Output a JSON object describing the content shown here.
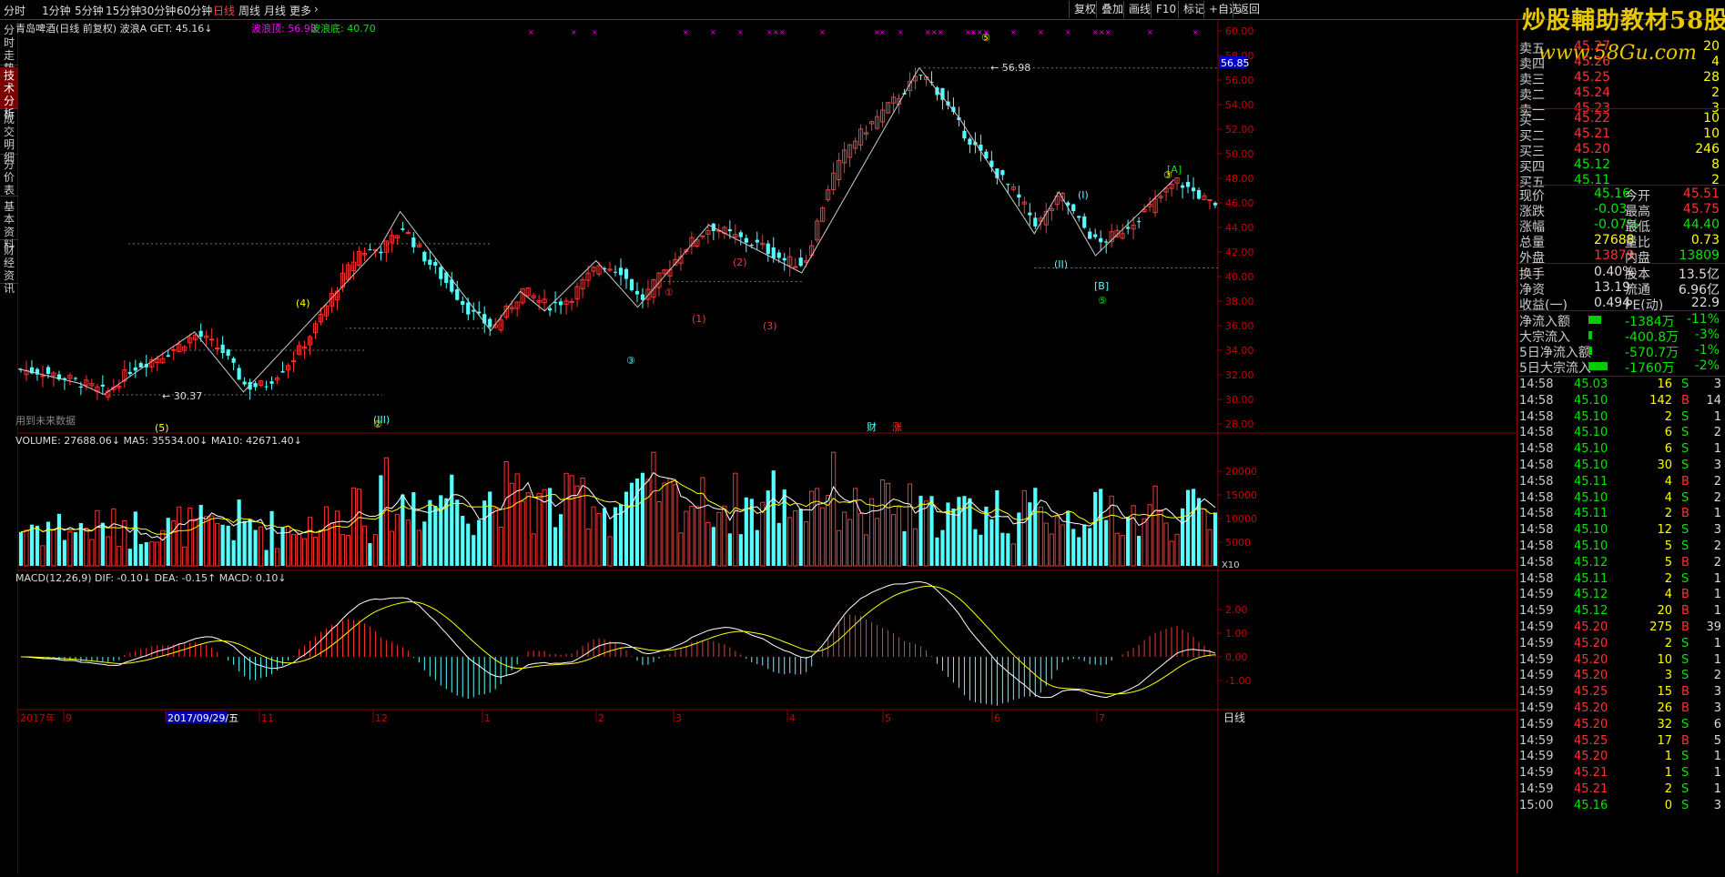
{
  "toolbar": {
    "periods": [
      "分时",
      "1分钟",
      "5分钟",
      "15分钟",
      "30分钟",
      "60分钟",
      "日线",
      "周线",
      "月线",
      "更多",
      "›"
    ],
    "active_period": "日线",
    "right_buttons": [
      "复权",
      "叠加",
      "画线",
      "F10",
      "标记",
      "+自选",
      "返回"
    ]
  },
  "left_tabs": [
    "分时走势",
    "技术分析",
    "成交明细",
    "分价表",
    "基本资料",
    "财经资讯"
  ],
  "active_left_tab": "技术分析",
  "watermark": {
    "line1": "炒股輔助教材58股网",
    "line2": "www.58Gu.com"
  },
  "main_chart": {
    "title": "青岛啤酒(日线 前复权) 波浪A  GET: 45.16↓",
    "wave_top_label": "波浪顶: 56.98",
    "wave_bottom_label": "波浪底: 40.70",
    "price_axis": [
      "60.00",
      "58.00",
      "56.00",
      "54.00",
      "52.00",
      "50.00",
      "48.00",
      "46.00",
      "44.00",
      "42.00",
      "40.00",
      "38.00",
      "36.00",
      "34.00",
      "32.00",
      "30.00",
      "28.00"
    ],
    "current_price_tag": "56.85",
    "peak_label": "56.98",
    "low_label": "30.37",
    "future_note": "用到未来数据",
    "cai_label": "财",
    "zhang_label": "涨"
  },
  "wave_labels": [
    "⑤",
    "①",
    "(1)",
    "(2)",
    "(3)",
    "(4)",
    "(5)",
    "②",
    "③",
    "(III)",
    "(II)",
    "(I)",
    "[B]",
    "[A]",
    "⑤",
    "③"
  ],
  "volume": {
    "title": "VOLUME: 27688.06↓  MA5: 35534.00↓  MA10: 42671.40↓",
    "axis": [
      "20000",
      "15000",
      "10000",
      "5000"
    ],
    "unit": "X10"
  },
  "macd": {
    "title": "MACD(12,26,9)  DIF: -0.10↓  DEA: -0.15↑  MACD: 0.10↓",
    "axis": [
      "2.00",
      "1.00",
      "0.00",
      "-1.00"
    ]
  },
  "time_axis": [
    "2017年",
    "9",
    "2017/09/29/五",
    "11",
    "12",
    "1",
    "2",
    "3",
    "4",
    "5",
    "6",
    "7"
  ],
  "bottom_tab": "日线",
  "order_book": {
    "sells": [
      {
        "label": "卖五",
        "price": "45.27",
        "vol": "20"
      },
      {
        "label": "卖四",
        "price": "45.26",
        "vol": "4"
      },
      {
        "label": "卖三",
        "price": "45.25",
        "vol": "28"
      },
      {
        "label": "卖二",
        "price": "45.24",
        "vol": "2"
      },
      {
        "label": "卖一",
        "price": "45.23",
        "vol": "3"
      }
    ],
    "buys": [
      {
        "label": "买一",
        "price": "45.22",
        "vol": "10"
      },
      {
        "label": "买二",
        "price": "45.21",
        "vol": "10"
      },
      {
        "label": "买三",
        "price": "45.20",
        "vol": "246"
      },
      {
        "label": "买四",
        "price": "45.12",
        "vol": "8"
      },
      {
        "label": "买五",
        "price": "45.11",
        "vol": "2"
      }
    ]
  },
  "quote": [
    {
      "l1": "现价",
      "v1": "45.16",
      "l2": "今开",
      "v2": "45.51"
    },
    {
      "l1": "涨跌",
      "v1": "-0.03",
      "l2": "最高",
      "v2": "45.75"
    },
    {
      "l1": "涨幅",
      "v1": "-0.07%",
      "l2": "最低",
      "v2": "44.40"
    },
    {
      "l1": "总量",
      "v1": "27688",
      "l2": "量比",
      "v2": "0.73"
    },
    {
      "l1": "外盘",
      "v1": "13879",
      "l2": "内盘",
      "v2": "13809"
    }
  ],
  "quote2": [
    {
      "l1": "换手",
      "v1": "0.40%",
      "l2": "股本",
      "v2": "13.5亿"
    },
    {
      "l1": "净资",
      "v1": "13.19",
      "l2": "流通",
      "v2": "6.96亿"
    },
    {
      "l1": "收益(一)",
      "v1": "0.494",
      "l2": "PE(动)",
      "v2": "22.9"
    }
  ],
  "flows": [
    {
      "label": "净流入额",
      "value": "-1384万",
      "pct": "-11%",
      "bar": 0.45
    },
    {
      "label": "大宗流入",
      "value": "-400.8万",
      "pct": "-3%",
      "bar": 0.1
    },
    {
      "label": "5日净流入额",
      "value": "-570.7万",
      "pct": "-1%",
      "bar": 0.05
    },
    {
      "label": "5日大宗流入",
      "value": "-1760万",
      "pct": "-2%",
      "bar": 0.7
    }
  ],
  "ticks": [
    {
      "t": "14:58",
      "p": "45.03",
      "v": "16",
      "s": "S",
      "n": "3"
    },
    {
      "t": "14:58",
      "p": "45.10",
      "v": "142",
      "s": "B",
      "n": "14"
    },
    {
      "t": "14:58",
      "p": "45.10",
      "v": "2",
      "s": "S",
      "n": "1"
    },
    {
      "t": "14:58",
      "p": "45.10",
      "v": "6",
      "s": "S",
      "n": "2"
    },
    {
      "t": "14:58",
      "p": "45.10",
      "v": "6",
      "s": "S",
      "n": "1"
    },
    {
      "t": "14:58",
      "p": "45.10",
      "v": "30",
      "s": "S",
      "n": "3"
    },
    {
      "t": "14:58",
      "p": "45.11",
      "v": "4",
      "s": "B",
      "n": "2"
    },
    {
      "t": "14:58",
      "p": "45.10",
      "v": "4",
      "s": "S",
      "n": "2"
    },
    {
      "t": "14:58",
      "p": "45.11",
      "v": "2",
      "s": "B",
      "n": "1"
    },
    {
      "t": "14:58",
      "p": "45.10",
      "v": "12",
      "s": "S",
      "n": "3"
    },
    {
      "t": "14:58",
      "p": "45.10",
      "v": "5",
      "s": "S",
      "n": "2"
    },
    {
      "t": "14:58",
      "p": "45.12",
      "v": "5",
      "s": "B",
      "n": "2"
    },
    {
      "t": "14:58",
      "p": "45.11",
      "v": "2",
      "s": "S",
      "n": "1"
    },
    {
      "t": "14:59",
      "p": "45.12",
      "v": "4",
      "s": "B",
      "n": "1"
    },
    {
      "t": "14:59",
      "p": "45.12",
      "v": "20",
      "s": "B",
      "n": "1"
    },
    {
      "t": "14:59",
      "p": "45.20",
      "v": "275",
      "s": "B",
      "n": "39"
    },
    {
      "t": "14:59",
      "p": "45.20",
      "v": "2",
      "s": "S",
      "n": "1"
    },
    {
      "t": "14:59",
      "p": "45.20",
      "v": "10",
      "s": "S",
      "n": "1"
    },
    {
      "t": "14:59",
      "p": "45.20",
      "v": "3",
      "s": "S",
      "n": "2"
    },
    {
      "t": "14:59",
      "p": "45.25",
      "v": "15",
      "s": "B",
      "n": "3"
    },
    {
      "t": "14:59",
      "p": "45.20",
      "v": "26",
      "s": "B",
      "n": "3"
    },
    {
      "t": "14:59",
      "p": "45.20",
      "v": "32",
      "s": "S",
      "n": "6"
    },
    {
      "t": "14:59",
      "p": "45.25",
      "v": "17",
      "s": "B",
      "n": "5"
    },
    {
      "t": "14:59",
      "p": "45.20",
      "v": "1",
      "s": "S",
      "n": "1"
    },
    {
      "t": "14:59",
      "p": "45.21",
      "v": "1",
      "s": "S",
      "n": "1"
    },
    {
      "t": "14:59",
      "p": "45.21",
      "v": "2",
      "s": "S",
      "n": "1"
    },
    {
      "t": "15:00",
      "p": "45.16",
      "v": "0",
      "s": "S",
      "n": "3"
    }
  ],
  "colors": {
    "up": "#ff3232",
    "down": "#54ffff",
    "green": "#00e600",
    "yellow": "#ffff00",
    "magenta": "#ff00ff"
  }
}
